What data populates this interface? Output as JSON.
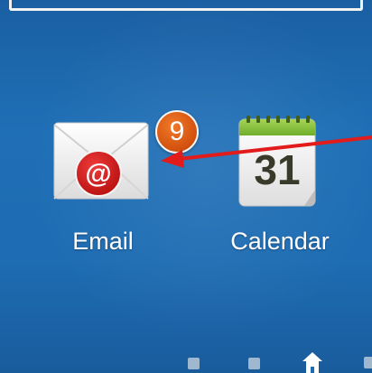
{
  "home_screen": {
    "apps": [
      {
        "label": "Email",
        "icon": "email-icon",
        "badge_count": "9",
        "badge_color": "#e0621a",
        "icon_accent": "#d42020"
      },
      {
        "label": "Calendar",
        "icon": "calendar-icon",
        "date": "31",
        "icon_accent": "#8cc43c"
      }
    ],
    "annotation": {
      "type": "arrow",
      "color": "#e21b1b",
      "points_to": "email-badge"
    },
    "page_indicator": {
      "pages": 4,
      "current": "home"
    },
    "background_color": "#1e6cb3"
  }
}
